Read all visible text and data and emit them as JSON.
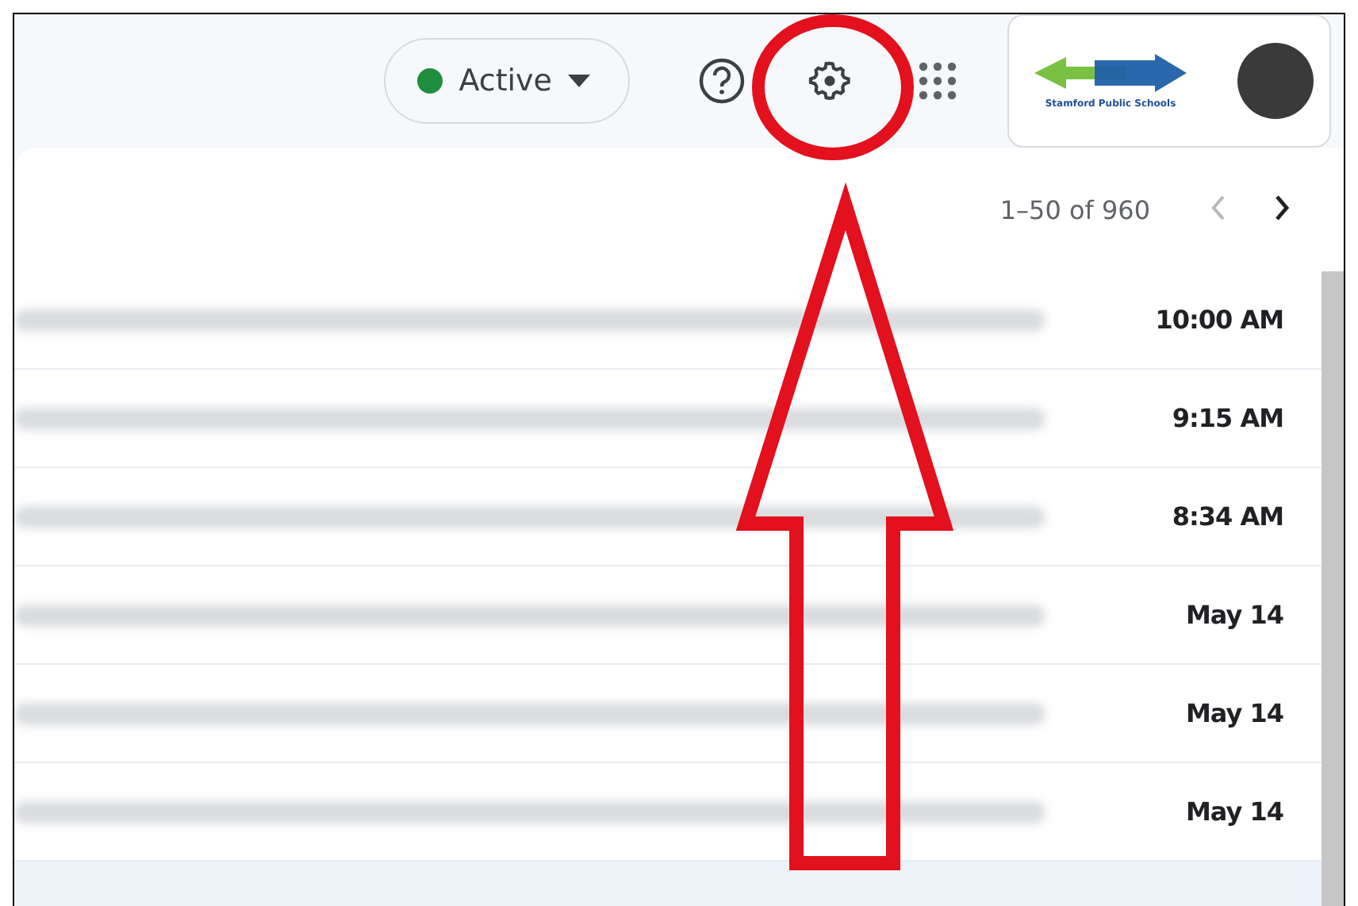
{
  "status": {
    "label": "Active",
    "color": "#1e8e3e"
  },
  "logo": {
    "text": "Stamford Public Schools"
  },
  "pagination": {
    "range": "1–50 of 960",
    "prev": {
      "disabled": true
    },
    "next": {
      "disabled": false
    }
  },
  "rows": [
    {
      "time": "10:00 AM",
      "selected": false
    },
    {
      "time": "9:15 AM",
      "selected": false
    },
    {
      "time": "8:34 AM",
      "selected": false
    },
    {
      "time": "May 14",
      "selected": false
    },
    {
      "time": "May 14",
      "selected": false
    },
    {
      "time": "May 14",
      "selected": false
    },
    {
      "selected": true
    }
  ]
}
